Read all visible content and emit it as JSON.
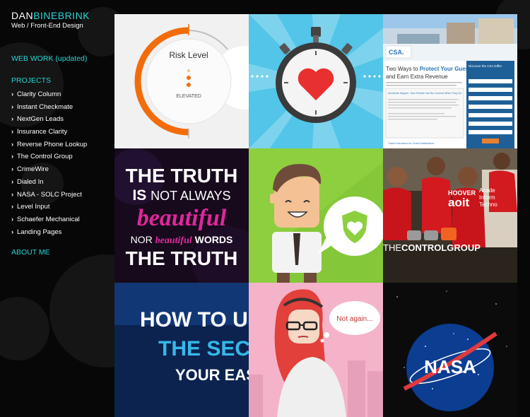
{
  "site": {
    "logo_first": "DAN",
    "logo_second": "BINEBRINK",
    "tagline": "Web / Front-End Design"
  },
  "nav": {
    "web_work": "WEB WORK (updated)",
    "projects_heading": "PROJECTS",
    "projects": [
      "Clarity Column",
      "Instant Checkmate",
      "NextGen Leads",
      "Insurance Clarity",
      "Reverse Phone Lookup",
      "The Control Group",
      "CrimeWire",
      "Dialed In",
      "NASA - SOLC Project",
      "Level Input",
      "Schaefer Mechanical",
      "Landing Pages"
    ],
    "chevron_glyph": "›",
    "about": "ABOUT ME"
  },
  "colors": {
    "accent": "#26d6d6"
  },
  "tiles": {
    "risk": {
      "title": "Risk Level",
      "status": "ELEVATED"
    },
    "csa": {
      "logo": "CSA.",
      "headline_a": "Two Ways to ",
      "headline_b": "Protect Your Guests",
      "headline_c": "and Earn Extra Revenue",
      "box_title": "Accidents Happen. Your Rentals Can Be Covered When They Do.",
      "side_title": "Discover the CSA Differ",
      "travel": "Travel Insurance for Guest Satisfaction"
    },
    "truth": {
      "line1": "THE TRUTH",
      "line2_a": "IS ",
      "line2_b": "NOT ALWAYS",
      "line3": "beautiful",
      "line4_a": "NOR ",
      "line4_b": "beautiful",
      "line4_c": " WORDS",
      "line5": "THE TRUTH"
    },
    "control": {
      "brand_a": "THE",
      "brand_b": "CONTROLGROUP",
      "logo": "HOOVER",
      "logo2": "aoit",
      "side1": "Acade",
      "side2": "Inform",
      "side3": "Techno"
    },
    "secrets": {
      "line1": "HOW TO UNCO",
      "line2": "THE SECRETS",
      "line3": "YOUR EAS"
    },
    "comic": {
      "bubble": "Not again..."
    },
    "nasa": {
      "label": "NASA"
    }
  }
}
